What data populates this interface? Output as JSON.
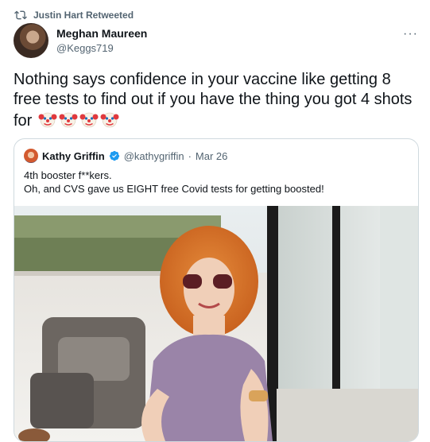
{
  "retweet": {
    "label": "Justin Hart Retweeted"
  },
  "tweet": {
    "author_name": "Meghan Maureen",
    "author_handle": "@Keggs719",
    "more": "···",
    "text": "Nothing says confidence in your vaccine like getting 8 free tests to find out if you have the thing you got 4 shots for",
    "emoji": [
      "clown-face",
      "clown-face",
      "clown-face",
      "clown-face"
    ]
  },
  "quoted": {
    "author_name": "Kathy Griffin",
    "author_handle": "@kathygriffin",
    "separator": "·",
    "date": "Mar 26",
    "line1": "4th booster f**kers.",
    "line2": "Oh, and CVS gave us EIGHT free Covid tests for getting boosted!"
  },
  "colors": {
    "secondary_text": "#536471",
    "verified": "#1d9bf0",
    "border": "#cfd9de"
  }
}
